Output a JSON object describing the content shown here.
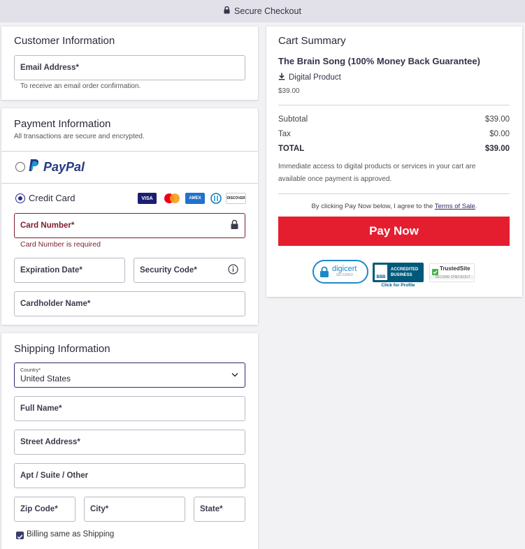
{
  "header": {
    "title": "Secure Checkout",
    "icon": "lock-icon"
  },
  "customer": {
    "title": "Customer Information",
    "email_label": "Email Address*",
    "email_hint": "To receive an email order confirmation."
  },
  "payment": {
    "title": "Payment Information",
    "subtitle": "All transactions are secure and encrypted.",
    "paypal_label": "PayPal",
    "credit_card_label": "Credit Card",
    "card_brands": [
      "VISA",
      "Mastercard",
      "AMEX",
      "Diners",
      "DISCOVER"
    ],
    "card_number_label": "Card Number*",
    "card_number_error": "Card Number is required",
    "expiration_label": "Expiration Date*",
    "security_code_label": "Security Code*",
    "cardholder_label": "Cardholder Name*",
    "selected_method": "Credit Card"
  },
  "shipping": {
    "title": "Shipping Information",
    "country_label": "Country*",
    "country_value": "United States",
    "full_name_label": "Full Name*",
    "street_label": "Street Address*",
    "apt_label": "Apt / Suite / Other",
    "zip_label": "Zip Code*",
    "city_label": "City*",
    "state_label": "State*",
    "billing_same_label": "Billing same as Shipping",
    "billing_same_checked": true
  },
  "cart": {
    "title": "Cart Summary",
    "product_name": "The Brain Song (100% Money Back Guarantee)",
    "product_type": "Digital Product",
    "product_price": "$39.00",
    "subtotal_label": "Subtotal",
    "subtotal_value": "$39.00",
    "tax_label": "Tax",
    "tax_value": "$0.00",
    "total_label": "TOTAL",
    "total_value": "$39.00",
    "access_note": "Immediate access to digital products or services in your cart are available once payment is approved.",
    "terms_prefix": "By clicking Pay Now below, I agree to the",
    "terms_link": "Terms of Sale",
    "terms_suffix": ".",
    "pay_button": "Pay Now"
  },
  "trust": {
    "digicert": "digicert",
    "digicert_sub": "SECURED",
    "bbb_line1": "ACCREDITED",
    "bbb_line2": "BUSINESS",
    "bbb_click": "Click for Profile",
    "bbb_logo": "BBB",
    "trustedsite": "TrustedSite",
    "trustedsite_sub": "SECURE CHECKOUT"
  },
  "colors": {
    "accent": "#e41e2f",
    "brand_navy": "#2a2a6a",
    "error": "#7b1f2e"
  }
}
